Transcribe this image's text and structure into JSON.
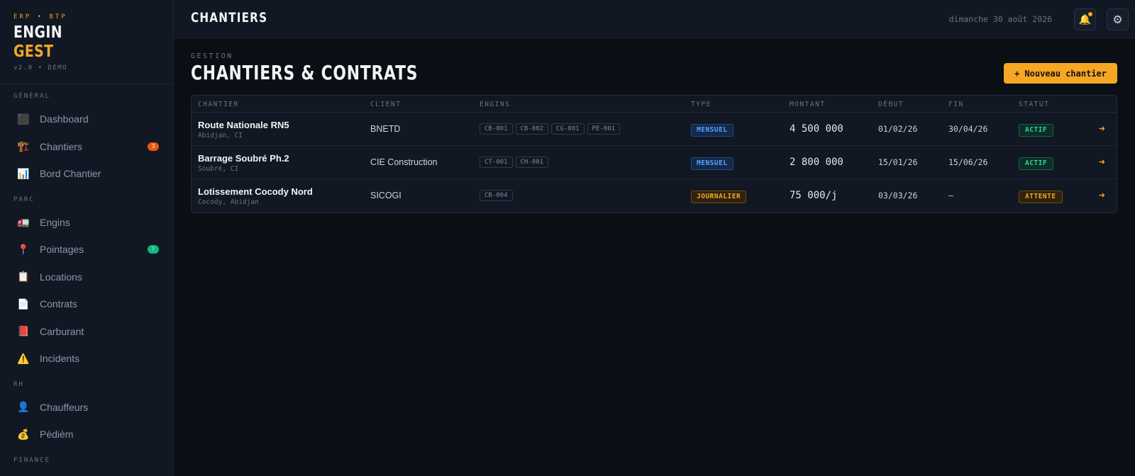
{
  "brand": {
    "tag": "ERP • BTP",
    "name_line1": "ENGIN",
    "name_line2": "GEST",
    "version": "v2.0 • DEMO"
  },
  "sidebar": {
    "sections": [
      {
        "label": "GÉNÉRAL",
        "items": [
          {
            "icon": "⬛",
            "icon_name": "dashboard-icon",
            "label": "Dashboard"
          },
          {
            "icon": "🏗️",
            "icon_name": "crane-icon",
            "label": "Chantiers",
            "badge": "3"
          },
          {
            "icon": "📊",
            "icon_name": "chart-icon",
            "label": "Bord Chantier"
          }
        ]
      },
      {
        "label": "PARC",
        "items": [
          {
            "icon": "🚛",
            "icon_name": "truck-icon",
            "label": "Engins"
          },
          {
            "icon": "📍",
            "icon_name": "pin-icon",
            "label": "Pointages",
            "badge": "!"
          },
          {
            "icon": "📋",
            "icon_name": "clipboard-icon",
            "label": "Locations"
          },
          {
            "icon": "📄",
            "icon_name": "document-icon",
            "label": "Contrats"
          },
          {
            "icon": "📕",
            "icon_name": "fuel-icon",
            "label": "Carburant"
          },
          {
            "icon": "⚠️",
            "icon_name": "warning-icon",
            "label": "Incidents"
          }
        ]
      },
      {
        "label": "RH",
        "items": [
          {
            "icon": "👤",
            "icon_name": "user-icon",
            "label": "Chauffeurs"
          },
          {
            "icon": "💰",
            "icon_name": "money-bag-icon",
            "label": "Pèdièm"
          }
        ]
      },
      {
        "label": "FINANCE",
        "items": [
          {
            "icon": "📄",
            "icon_name": "document-icon",
            "label": ""
          }
        ]
      }
    ]
  },
  "topbar": {
    "title": "CHANTIERS",
    "date": "dimanche 30 août 2026",
    "bell_icon": "🔔",
    "gear_icon": "⚙"
  },
  "page": {
    "eyebrow": "GESTION",
    "title": "CHANTIERS & CONTRATS",
    "new_button": "+ Nouveau chantier"
  },
  "table": {
    "headers": {
      "chantier": "CHANTIER",
      "client": "CLIENT",
      "engins": "ENGINS",
      "type": "TYPE",
      "montant": "MONTANT",
      "debut": "DÉBUT",
      "fin": "FIN",
      "statut": "STATUT"
    },
    "rows": [
      {
        "name": "Route Nationale RN5",
        "location": "Abidjan, CI",
        "client": "BNETD",
        "engins": [
          "CB-001",
          "CB-002",
          "CG-001",
          "PE-001"
        ],
        "type": "MENSUEL",
        "montant": "4 500 000",
        "debut": "01/02/26",
        "fin": "30/04/26",
        "statut": "ACTIF",
        "arrow": "➜"
      },
      {
        "name": "Barrage Soubré Ph.2",
        "location": "Soubré, CI",
        "client": "CIE Construction",
        "engins": [
          "CT-001",
          "CH-001"
        ],
        "type": "MENSUEL",
        "montant": "2 800 000",
        "debut": "15/01/26",
        "fin": "15/06/26",
        "statut": "ACTIF",
        "arrow": "➜"
      },
      {
        "name": "Lotissement Cocody Nord",
        "location": "Cocody, Abidjan",
        "client": "SICOGI",
        "engins": [
          "CB-004"
        ],
        "type": "JOURNALIER",
        "montant": "75 000/j",
        "debut": "03/03/26",
        "fin": "—",
        "statut": "ATTENTE",
        "arrow": "➜"
      }
    ]
  }
}
